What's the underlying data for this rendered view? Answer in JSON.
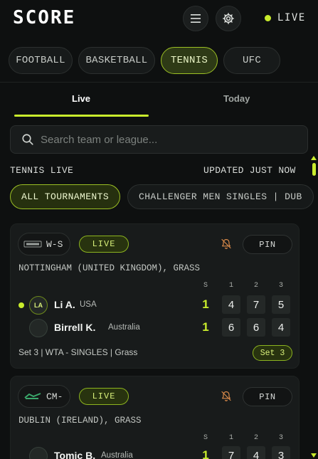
{
  "header": {
    "brand": "SCORE",
    "live_label": "LIVE",
    "icons": {
      "menu": "menu-icon",
      "settings": "gear-icon"
    }
  },
  "sports": [
    {
      "label": "FOOTBALL",
      "active": false
    },
    {
      "label": "BASKETBALL",
      "active": false
    },
    {
      "label": "TENNIS",
      "active": true
    },
    {
      "label": "UFC",
      "active": false
    }
  ],
  "tabs": {
    "live": "Live",
    "today": "Today",
    "selected": "live"
  },
  "search": {
    "placeholder": "Search team or league..."
  },
  "section": {
    "title": "TENNIS LIVE",
    "updated": "UPDATED JUST NOW"
  },
  "filters": [
    {
      "label": "ALL TOURNAMENTS",
      "active": true
    },
    {
      "label": "CHALLENGER MEN SINGLES | DUB",
      "active": false
    }
  ],
  "matches": [
    {
      "tour_code": "W-S",
      "status": "LIVE",
      "pin_label": "PIN",
      "venue": "NOTTINGHAM (UNITED KINGDOM), GRASS",
      "columns": [
        "S",
        "1",
        "2",
        "3"
      ],
      "players": [
        {
          "initials": "LA",
          "name": "Li A.",
          "country": "USA",
          "serving": true,
          "sets": "1",
          "games": [
            "4",
            "7",
            "5"
          ]
        },
        {
          "initials": "",
          "name": "Birrell K.",
          "country": "Australia",
          "serving": false,
          "sets": "1",
          "games": [
            "6",
            "6",
            "4"
          ]
        }
      ],
      "footer": "Set 3 | WTA - SINGLES | Grass",
      "current_set": "Set 3"
    },
    {
      "tour_code": "CM-",
      "status": "LIVE",
      "pin_label": "PIN",
      "venue": "DUBLIN (IRELAND), GRASS",
      "columns": [
        "S",
        "1",
        "2",
        "3"
      ],
      "players": [
        {
          "initials": "",
          "name": "Tomic B.",
          "country": "Australia",
          "serving": false,
          "sets": "1",
          "games": [
            "7",
            "4",
            "3"
          ]
        }
      ]
    }
  ],
  "colors": {
    "accent": "#c9ec2c",
    "background": "#0e1010",
    "card": "#181b1b"
  }
}
